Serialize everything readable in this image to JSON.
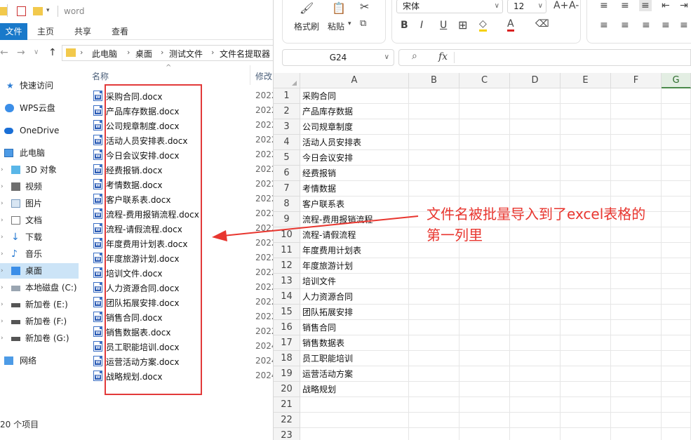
{
  "explorer": {
    "title": "word",
    "ribbon_tabs": [
      "文件",
      "主页",
      "共享",
      "查看"
    ],
    "breadcrumbs": [
      "此电脑",
      "桌面",
      "测试文件",
      "文件名提取器"
    ],
    "nav_items": [
      "快速访问",
      "WPS云盘",
      "OneDrive",
      "此电脑",
      "3D 对象",
      "视频",
      "图片",
      "文档",
      "下载",
      "音乐",
      "桌面",
      "本地磁盘 (C:)",
      "新加卷 (E:)",
      "新加卷 (F:)",
      "新加卷 (G:)",
      "网络"
    ],
    "col_name": "名称",
    "col_modified": "修改",
    "files": [
      {
        "name": "采购合同.docx",
        "date": "2022"
      },
      {
        "name": "产品库存数据.docx",
        "date": "2022"
      },
      {
        "name": "公司规章制度.docx",
        "date": "2022"
      },
      {
        "name": "活动人员安排表.docx",
        "date": "2022"
      },
      {
        "name": "今日会议安排.docx",
        "date": "2022"
      },
      {
        "name": "经费报销.docx",
        "date": "2022"
      },
      {
        "name": "考情数据.docx",
        "date": "2022"
      },
      {
        "name": "客户联系表.docx",
        "date": "2022"
      },
      {
        "name": "流程-费用报销流程.docx",
        "date": "2022"
      },
      {
        "name": "流程-请假流程.docx",
        "date": "2022"
      },
      {
        "name": "年度费用计划表.docx",
        "date": "2022"
      },
      {
        "name": "年度旅游计划.docx",
        "date": "2022"
      },
      {
        "name": "培训文件.docx",
        "date": "2022"
      },
      {
        "name": "人力资源合同.docx",
        "date": "2022"
      },
      {
        "name": "团队拓展安排.docx",
        "date": "2022"
      },
      {
        "name": "销售合同.docx",
        "date": "2022"
      },
      {
        "name": "销售数据表.docx",
        "date": "2022"
      },
      {
        "name": "员工职能培训.docx",
        "date": "2024"
      },
      {
        "name": "运营活动方案.docx",
        "date": "2024"
      },
      {
        "name": "战略规划.docx",
        "date": "2024"
      }
    ],
    "status": "20 个项目"
  },
  "sheet": {
    "ribbon": {
      "format_painter": "格式刷",
      "paste": "粘贴",
      "font_name": "宋体",
      "font_size": "12",
      "bold": "B",
      "italic": "I",
      "underline": "U",
      "font_grow": "A+",
      "font_shrink": "A-"
    },
    "name_box": "G24",
    "fx_label": "fx",
    "columns": [
      "A",
      "B",
      "C",
      "D",
      "E",
      "F",
      "G"
    ],
    "rows": [
      "1",
      "2",
      "3",
      "4",
      "5",
      "6",
      "7",
      "8",
      "9",
      "10",
      "11",
      "12",
      "13",
      "14",
      "15",
      "16",
      "17",
      "18",
      "19",
      "20",
      "21",
      "22",
      "23"
    ],
    "column_a": [
      "采购合同",
      "产品库存数据",
      "公司规章制度",
      "活动人员安排表",
      "今日会议安排",
      "经费报销",
      "考情数据",
      "客户联系表",
      "流程-费用报销流程",
      "流程-请假流程",
      "年度费用计划表",
      "年度旅游计划",
      "培训文件",
      "人力资源合同",
      "团队拓展安排",
      "销售合同",
      "销售数据表",
      "员工职能培训",
      "运营活动方案",
      "战略规划"
    ]
  },
  "annotation": {
    "line1": "文件名被批量导入到了excel表格的",
    "line2": "第一列里",
    "color": "#e8362f"
  },
  "colors": {
    "accent_blue": "#1979ca",
    "highlight_red": "#e23a3a",
    "selected_col": "#4a8a4a"
  }
}
